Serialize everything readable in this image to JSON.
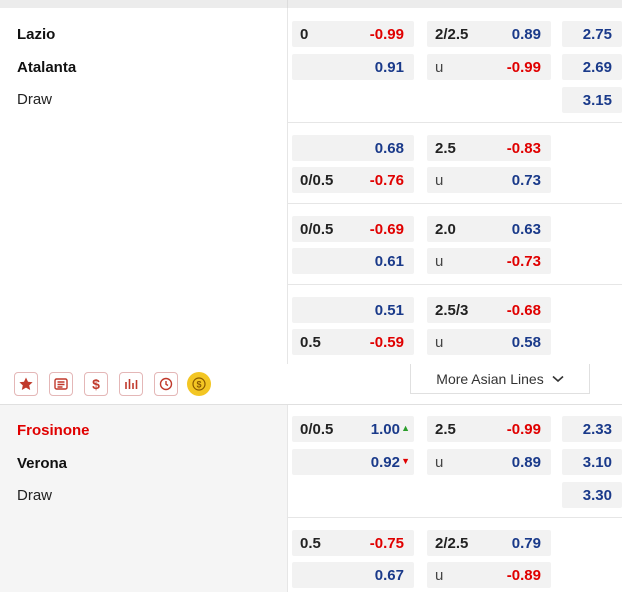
{
  "match1": {
    "home": "Lazio",
    "away": "Atalanta",
    "draw": "Draw",
    "lines": [
      {
        "ah_home_line": "0",
        "ah_home_odds": "-0.99",
        "ah_away_line": "",
        "ah_away_odds": "0.91",
        "ou_line": "2/2.5",
        "ou_over": "0.89",
        "ou_u": "u",
        "ou_under": "-0.99"
      },
      {
        "ah_home_line": "",
        "ah_home_odds": "0.68",
        "ah_away_line": "0/0.5",
        "ah_away_odds": "-0.76",
        "ou_line": "2.5",
        "ou_over": "-0.83",
        "ou_u": "u",
        "ou_under": "0.73"
      },
      {
        "ah_home_line": "0/0.5",
        "ah_home_odds": "-0.69",
        "ah_away_line": "",
        "ah_away_odds": "0.61",
        "ou_line": "2.0",
        "ou_over": "0.63",
        "ou_u": "u",
        "ou_under": "-0.73"
      },
      {
        "ah_home_line": "",
        "ah_home_odds": "0.51",
        "ah_away_line": "0.5",
        "ah_away_odds": "-0.59",
        "ou_line": "2.5/3",
        "ou_over": "-0.68",
        "ou_u": "u",
        "ou_under": "0.58"
      }
    ],
    "x12": [
      "2.75",
      "2.69",
      "3.15"
    ]
  },
  "actions": {
    "icons": [
      "star-icon",
      "ticket-icon",
      "dollar-icon",
      "bar-chart-icon",
      "history-icon",
      "cash-coin-icon"
    ],
    "more_label": "More Asian Lines"
  },
  "match2": {
    "home": "Frosinone",
    "away": "Verona",
    "draw": "Draw",
    "lines": [
      {
        "ah_home_line": "0/0.5",
        "ah_home_odds": "1.00",
        "ah_away_line": "",
        "ah_away_odds": "0.92",
        "ou_line": "2.5",
        "ou_over": "-0.99",
        "ou_u": "u",
        "ou_under": "0.89"
      },
      {
        "ah_home_line": "0.5",
        "ah_home_odds": "-0.75",
        "ah_away_line": "",
        "ah_away_odds": "0.67",
        "ou_line": "2/2.5",
        "ou_over": "0.79",
        "ou_u": "u",
        "ou_under": "-0.89"
      }
    ],
    "x12": [
      "2.33",
      "3.10",
      "3.30"
    ]
  },
  "colors": {
    "negative": "#e00000",
    "positive": "#1a3a8a",
    "highlight_team": "#e00000",
    "arrow_up": "#2a9d2a",
    "arrow_down": "#e00000"
  }
}
